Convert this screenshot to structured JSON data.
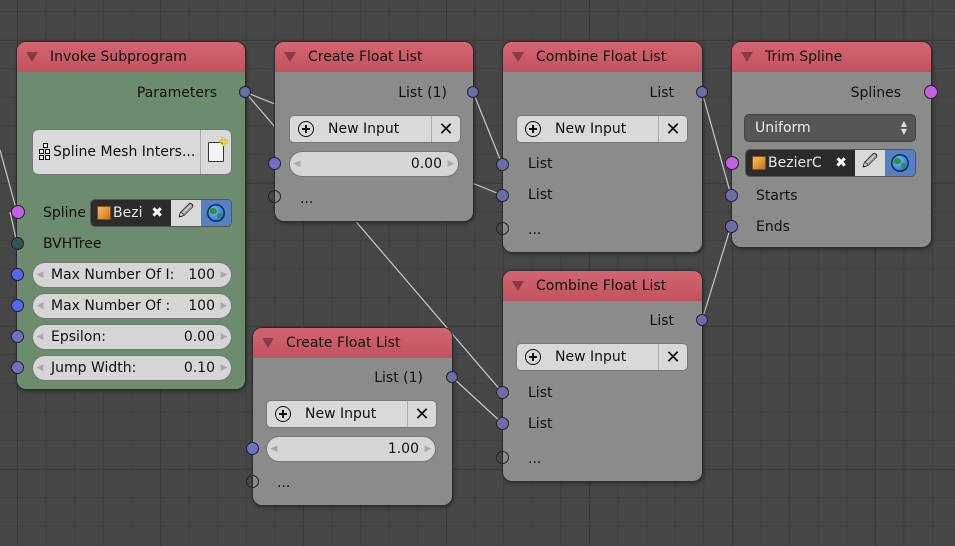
{
  "nodes": {
    "invoke_subprogram": {
      "title": "Invoke Subprogram",
      "output": "Parameters",
      "program": "Spline Mesh Inters...",
      "spline_label": "Spline",
      "spline_object": "Bezi",
      "bvh_label": "BVHTree",
      "fields": [
        {
          "label": "Max Number Of I:",
          "value": "100"
        },
        {
          "label": "Max Number Of :",
          "value": "100"
        },
        {
          "label": "Epsilon:",
          "value": "0.00"
        },
        {
          "label": "Jump Width:",
          "value": "0.10"
        }
      ]
    },
    "create_float_list_1": {
      "title": "Create Float List",
      "output": "List (1)",
      "new_input": "New Input",
      "value": "0.00",
      "more": "..."
    },
    "create_float_list_2": {
      "title": "Create Float List",
      "output": "List (1)",
      "new_input": "New Input",
      "value": "1.00",
      "more": "..."
    },
    "combine_float_list_1": {
      "title": "Combine Float List",
      "output": "List",
      "new_input": "New Input",
      "inputs": [
        "List",
        "List"
      ],
      "more": "..."
    },
    "combine_float_list_2": {
      "title": "Combine Float List",
      "output": "List",
      "new_input": "New Input",
      "inputs": [
        "List",
        "List"
      ],
      "more": "..."
    },
    "trim_spline": {
      "title": "Trim Spline",
      "output": "Splines",
      "mode": "Uniform",
      "object": "BezierC",
      "inputs": [
        "Starts",
        "Ends"
      ]
    }
  },
  "icons": {
    "remove": "✕",
    "eyedropper": "🖉",
    "clear": "✖",
    "arrow_left": "◀",
    "arrow_right": "▶",
    "updown_up": "▲",
    "updown_down": "▼"
  },
  "colors": {
    "header": "#c95966",
    "node_body": "#8b8b8b",
    "subprogram_body": "#6d8c6f",
    "socket_list": "#6c6ca6",
    "socket_spline": "#c560e6",
    "socket_int": "#5268f0",
    "socket_bvh": "#2e5353"
  }
}
